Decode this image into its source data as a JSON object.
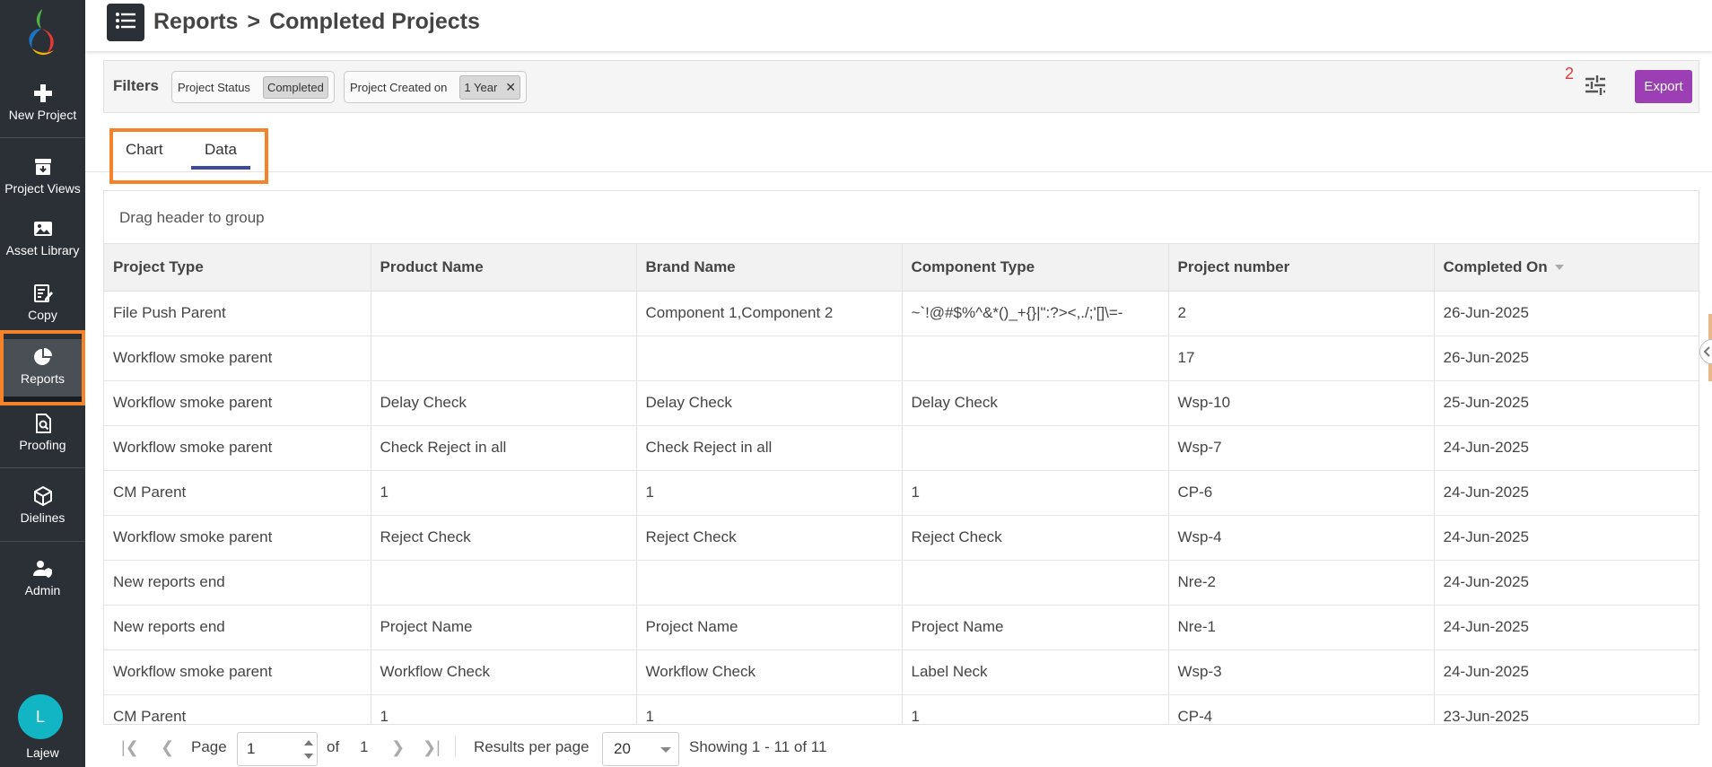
{
  "sidebar": {
    "items": [
      {
        "label": "New Project",
        "icon": "plus-icon"
      },
      {
        "label": "Project Views",
        "icon": "archive-icon"
      },
      {
        "label": "Asset Library",
        "icon": "image-icon"
      },
      {
        "label": "Copy",
        "icon": "edit-note-icon"
      },
      {
        "label": "Reports",
        "icon": "pie-chart-icon"
      },
      {
        "label": "Proofing",
        "icon": "doc-search-icon"
      },
      {
        "label": "Dielines",
        "icon": "box-icon"
      },
      {
        "label": "Admin",
        "icon": "user-shield-icon"
      }
    ],
    "active": "Reports",
    "user": {
      "initial": "L",
      "name": "Lajew"
    }
  },
  "header": {
    "crumb_root": "Reports",
    "crumb_sep": ">",
    "crumb_current": "Completed Projects"
  },
  "filters": {
    "label": "Filters",
    "chips": [
      {
        "name": "Project Status",
        "value": "Completed",
        "removable": false
      },
      {
        "name": "Project Created on",
        "value": "1 Year",
        "removable": true
      }
    ],
    "remove_glyph": "✕",
    "count": "2",
    "export_label": "Export"
  },
  "tabs": [
    {
      "label": "Chart",
      "active": false
    },
    {
      "label": "Data",
      "active": true
    }
  ],
  "grid": {
    "group_hint": "Drag header to group",
    "columns": [
      "Project Type",
      "Product Name",
      "Brand Name",
      "Component Type",
      "Project number",
      "Completed On"
    ],
    "sorted_column": "Completed On",
    "rows": [
      [
        "File Push Parent",
        "",
        "Component 1,Component 2",
        "~`!@#$%^&*()_+{}|\":?><,./;'[]\\=-",
        "2",
        "26-Jun-2025"
      ],
      [
        "Workflow smoke parent",
        "",
        "",
        "",
        "17",
        "26-Jun-2025"
      ],
      [
        "Workflow smoke parent",
        "Delay Check",
        "Delay Check",
        "Delay Check",
        "Wsp-10",
        "25-Jun-2025"
      ],
      [
        "Workflow smoke parent",
        "Check Reject in all",
        "Check Reject in all",
        "",
        "Wsp-7",
        "24-Jun-2025"
      ],
      [
        "CM Parent",
        "1",
        "1",
        "1",
        "CP-6",
        "24-Jun-2025"
      ],
      [
        "Workflow smoke parent",
        "Reject Check",
        "Reject Check",
        "Reject Check",
        "Wsp-4",
        "24-Jun-2025"
      ],
      [
        "New reports end",
        "",
        "",
        "",
        "Nre-2",
        "24-Jun-2025"
      ],
      [
        "New reports end",
        "Project Name",
        "Project Name",
        "Project Name",
        "Nre-1",
        "24-Jun-2025"
      ],
      [
        "Workflow smoke parent",
        "Workflow Check",
        "Workflow Check",
        "Label Neck",
        "Wsp-3",
        "24-Jun-2025"
      ],
      [
        "CM Parent",
        "1",
        "1",
        "1",
        "CP-4",
        "23-Jun-2025"
      ]
    ]
  },
  "pager": {
    "page_label": "Page",
    "page_value": "1",
    "of_label": "of",
    "total_pages": "1",
    "results_label": "Results per page",
    "per_page": "20",
    "showing": "Showing 1 - 11 of 11"
  },
  "colors": {
    "sidebar_bg": "#2b2f36",
    "accent_highlight": "#f5832a",
    "export_btn": "#9c3fb5",
    "tab_underline": "#3f4a9b",
    "avatar": "#11b5c4"
  }
}
